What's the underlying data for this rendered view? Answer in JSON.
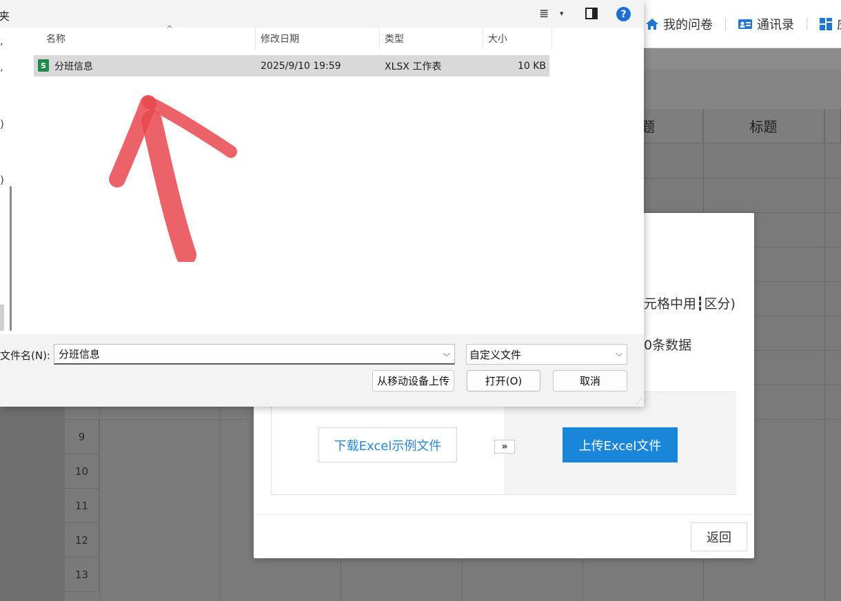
{
  "topnav": {
    "my_surveys": "我的问卷",
    "contacts": "通讯录",
    "more_fragment": "应"
  },
  "sheet": {
    "headers": [
      "题",
      "标题"
    ],
    "row_numbers": [
      "9",
      "10",
      "11",
      "12",
      "13"
    ]
  },
  "import_modal": {
    "hint_line1_fragment": "元格中用┇区分)",
    "hint_line2_fragment": "0条数据",
    "download_sample_label": "下载Excel示例文件",
    "arrow_label": "»",
    "upload_label": "上传Excel文件",
    "back_label": "返回"
  },
  "file_dialog": {
    "title_fragment": "夹",
    "help_label": "?",
    "view_toggle_label": "≣",
    "view_dropdown_label": "▾",
    "columns": {
      "name": "名称",
      "modified": "修改日期",
      "type": "类型",
      "size": "大小"
    },
    "sort_caret": "^",
    "files": [
      {
        "icon": "xlsx-file-icon",
        "icon_label": "S",
        "name": "分班信息",
        "modified": "2025/9/10 19:59",
        "type": "XLSX 工作表",
        "size": "10 KB"
      }
    ],
    "nav_fragments": [
      ",",
      ")",
      ")"
    ],
    "filename_label": "文件名(N):",
    "filename_value": "分班信息",
    "filetype_value": "自定义文件",
    "chevron": "⌵",
    "upload_mobile_label": "从移动设备上传",
    "open_label": "打开(O)",
    "cancel_label": "取消"
  },
  "colors": {
    "accent_blue": "#1a86d9",
    "link_blue": "#2a86d8",
    "xlsx_green": "#1f8a4c",
    "annotation_red": "#e8484e"
  }
}
